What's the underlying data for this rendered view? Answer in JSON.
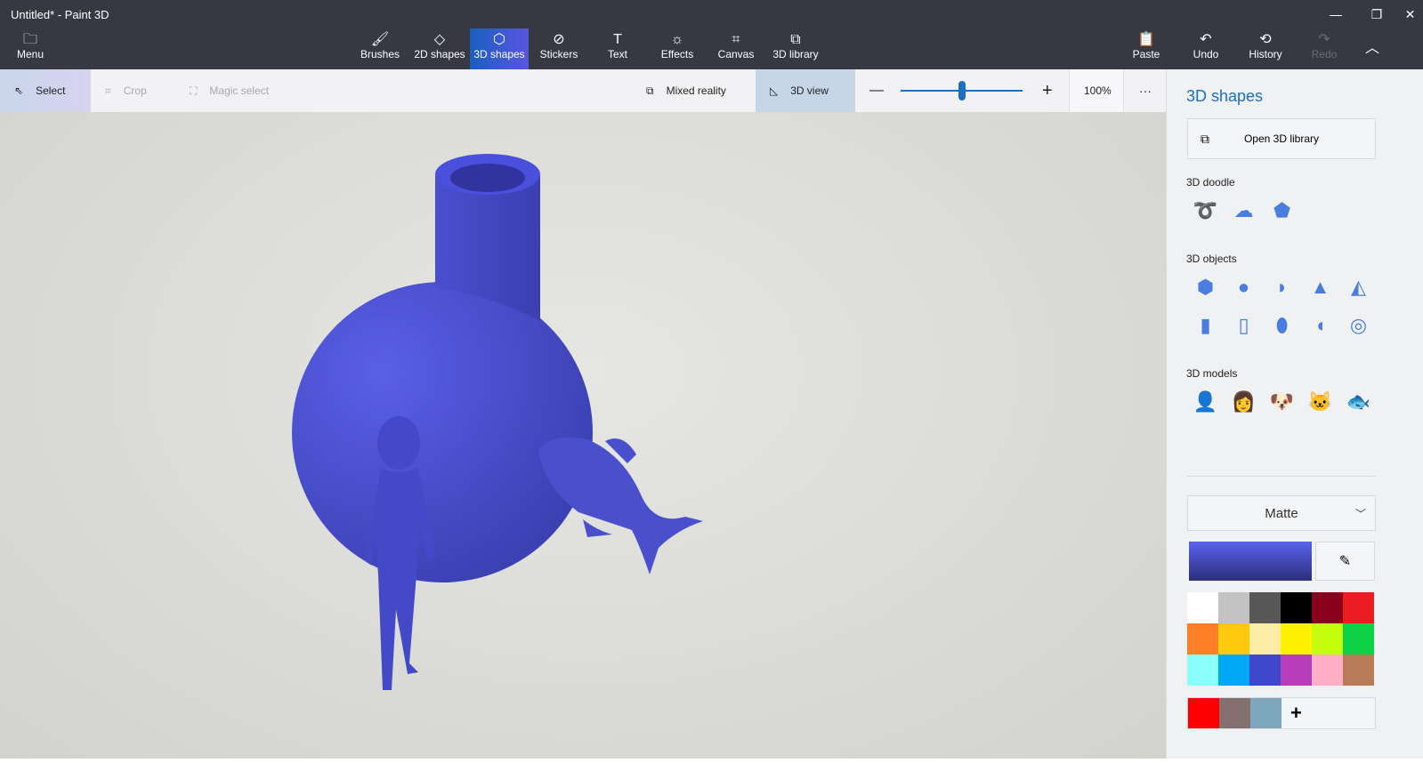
{
  "window": {
    "title": "Untitled* - Paint 3D",
    "minimize": "—",
    "restore": "❐",
    "close": "✕"
  },
  "ribbon": {
    "menu": "Menu",
    "tabs": [
      {
        "label": "Brushes",
        "icon": "🖌"
      },
      {
        "label": "2D shapes",
        "icon": "◇"
      },
      {
        "label": "3D shapes",
        "icon": "⬡"
      },
      {
        "label": "Stickers",
        "icon": "⊘"
      },
      {
        "label": "Text",
        "icon": "T"
      },
      {
        "label": "Effects",
        "icon": "☼"
      },
      {
        "label": "Canvas",
        "icon": "⌗"
      },
      {
        "label": "3D library",
        "icon": "⧉"
      }
    ],
    "paste": "Paste",
    "undo": "Undo",
    "history": "History",
    "redo": "Redo",
    "collapse": "︿"
  },
  "toolbar": {
    "select": "Select",
    "crop": "Crop",
    "magic_select": "Magic select",
    "mixed_reality": "Mixed reality",
    "view3d": "3D view",
    "zoom_value": "100%",
    "zoom_level": 0.5,
    "more": "···",
    "minus": "—",
    "plus": "+"
  },
  "panel": {
    "title": "3D shapes",
    "open_library": "Open 3D library",
    "doodle": "3D doodle",
    "objects": "3D objects",
    "models": "3D models",
    "material": "Matte",
    "current_color": "#4b52d8",
    "palette": [
      "#ffffff",
      "#c3c3c3",
      "#585858",
      "#000000",
      "#88001b",
      "#ec1c24",
      "#ff7f27",
      "#ffc90e",
      "#fdeca6",
      "#fff200",
      "#c4ff0e",
      "#0ed145",
      "#8cfffb",
      "#00a8f3",
      "#3f48cc",
      "#b83dba",
      "#ffaec8",
      "#b97a57"
    ],
    "custom_colors": [
      "#ff0000",
      "#857070",
      "#7ea7be"
    ],
    "add": "+"
  }
}
